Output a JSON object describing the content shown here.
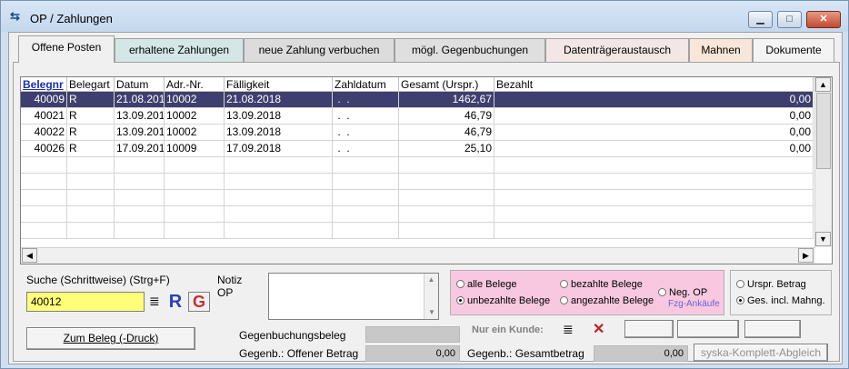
{
  "window": {
    "title": "OP / Zahlungen",
    "min": "▁",
    "max": "□",
    "close": "✕"
  },
  "tabs": [
    {
      "label": "Offene Posten",
      "color": "#f0f0f0"
    },
    {
      "label": "erhaltene Zahlungen",
      "color": "#d3e7e6"
    },
    {
      "label": "neue Zahlung verbuchen",
      "color": "#dcdcdc"
    },
    {
      "label": "mögl. Gegenbuchungen",
      "color": "#dfdfdf"
    },
    {
      "label": "Datenträgeraustausch",
      "color": "#f2e6e6"
    },
    {
      "label": "Mahnen",
      "color": "#f9e6da"
    },
    {
      "label": "Dokumente",
      "color": "#f4f4f4"
    }
  ],
  "table": {
    "columns": [
      "Belegnr",
      "Belegart",
      "Datum",
      "Adr.-Nr.",
      "Fälligkeit",
      "Zahldatum",
      "Gesamt (Urspr.)",
      "Bezahlt"
    ],
    "rows": [
      [
        "40009",
        "R",
        "21.08.201",
        "10002",
        "21.08.2018",
        " .  .",
        "1462,67",
        "0,00"
      ],
      [
        "40021",
        "R",
        "13.09.201",
        "10002",
        "13.09.2018",
        " .  .",
        "46,79",
        "0,00"
      ],
      [
        "40022",
        "R",
        "13.09.201",
        "10002",
        "13.09.2018",
        " .  .",
        "46,79",
        "0,00"
      ],
      [
        "40026",
        "R",
        "17.09.201",
        "10009",
        "17.09.2018",
        " .  .",
        "25,10",
        "0,00"
      ]
    ]
  },
  "search": {
    "label": "Suche (Schrittweise) (Strg+F)",
    "value": "40012",
    "r_label": "R",
    "g_label": "G"
  },
  "notiz": {
    "label": "Notiz",
    "sublabel": "OP"
  },
  "filter": {
    "alle": "alle Belege",
    "bezahlte": "bezahlte Belege",
    "unbezahlte": "unbezahlte Belege",
    "angezahlte": "angezahlte Belege",
    "neg_op": "Neg. OP",
    "fzg": "Fzg-Ankäufe"
  },
  "betrag": {
    "urspr": "Urspr. Betrag",
    "ges": "Ges. incl. Mahng."
  },
  "zum_beleg": "Zum Beleg (-Druck)",
  "gegen": {
    "beleg_label": "Gegenbuchungsbeleg",
    "offener_label": "Gegenb.: Offener Betrag",
    "offener_value": "0,00",
    "kunde_label": "Nur ein Kunde:",
    "gesamt_label": "Gegenb.: Gesamtbetrag",
    "gesamt_value": "0,00"
  },
  "syska_button": "syska-Komplett-Abgleich",
  "colors": {
    "selected_row": "#3e3f6e",
    "search_bg": "#ffff7a",
    "filter_bg": "#f7c8e0",
    "r_color": "#2b3fb8",
    "g_color": "#c23030"
  }
}
